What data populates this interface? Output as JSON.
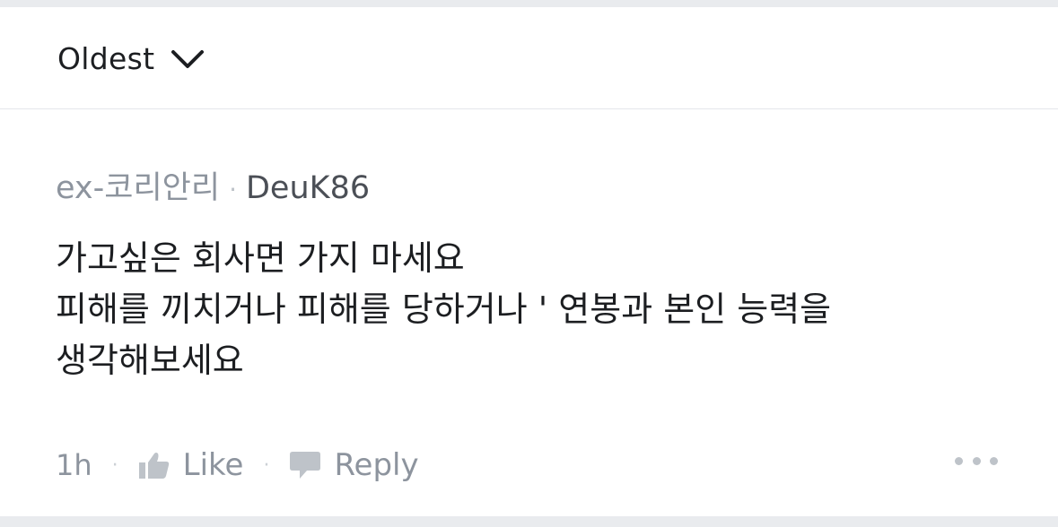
{
  "sort": {
    "label": "Oldest",
    "icon": "chevron-down-icon"
  },
  "comment": {
    "company": "ex-코리안리",
    "separator": "·",
    "username": "DeuK86",
    "lines": [
      "가고싶은 회사면 가지 마세요",
      "피해를 끼치거나 피해를 당하거나 ' 연봉과 본인 능력을",
      "생각해보세요"
    ],
    "time": "1h",
    "like_label": "Like",
    "reply_label": "Reply"
  },
  "colors": {
    "background": "#e9ebee",
    "panel": "#ffffff",
    "text_primary": "#1c1e21",
    "text_secondary": "#8d949e"
  }
}
